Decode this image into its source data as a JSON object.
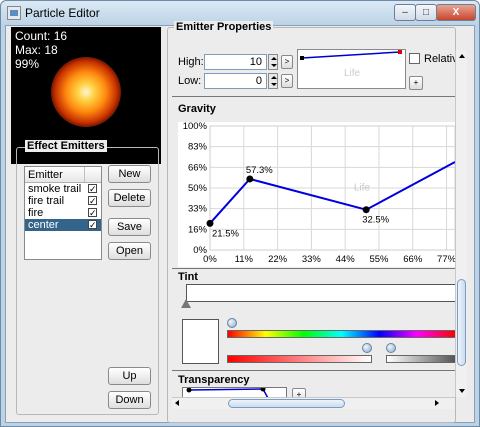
{
  "window": {
    "title": "Particle Editor",
    "buttons": {
      "minimize": "–",
      "maximize": "□",
      "close": "X"
    }
  },
  "preview": {
    "count": "Count: 16",
    "max": "Max: 18",
    "percent": "99%"
  },
  "emitters": {
    "legend": "Effect Emitters",
    "column_header": "Emitter",
    "rows": [
      {
        "name": "smoke trail",
        "enabled": true,
        "selected": false
      },
      {
        "name": "fire trail",
        "enabled": true,
        "selected": false
      },
      {
        "name": "fire",
        "enabled": true,
        "selected": false
      },
      {
        "name": "center",
        "enabled": true,
        "selected": true
      }
    ],
    "check_mark": "✓",
    "buttons": {
      "new": "New",
      "delete": "Delete",
      "save": "Save",
      "open": "Open",
      "up": "Up",
      "down": "Down"
    }
  },
  "properties": {
    "legend": "Emitter Properties",
    "high_label": "High:",
    "high_value": "10",
    "low_label": "Low:",
    "low_value": "0",
    "arrow_button": ">",
    "plus_button": "+",
    "relative_label": "Relative",
    "life_label": "Life"
  },
  "gravity": {
    "title": "Gravity",
    "life_label": "Life"
  },
  "tint": {
    "title": "Tint",
    "swatch_color": "#ffffff"
  },
  "transparency": {
    "title": "Transparency",
    "plus_button": "+"
  },
  "chart_data": {
    "type": "line",
    "title": "Gravity",
    "xlabel": "Life",
    "x_ticks": [
      "0%",
      "11%",
      "22%",
      "33%",
      "44%",
      "55%",
      "66%",
      "77%"
    ],
    "y_ticks": [
      "100%",
      "83%",
      "66%",
      "50%",
      "33%",
      "16%",
      "0%"
    ],
    "xlim": [
      0,
      80
    ],
    "ylim": [
      0,
      100
    ],
    "grid": true,
    "line_color": "#0000dd",
    "points": [
      {
        "x": 0,
        "y": 21.5,
        "label": "21.5%"
      },
      {
        "x": 13,
        "y": 57.3,
        "label": "57.3%"
      },
      {
        "x": 51,
        "y": 32.5,
        "label": "32.5%"
      },
      {
        "x": 80,
        "y": 71,
        "label": ""
      }
    ]
  }
}
